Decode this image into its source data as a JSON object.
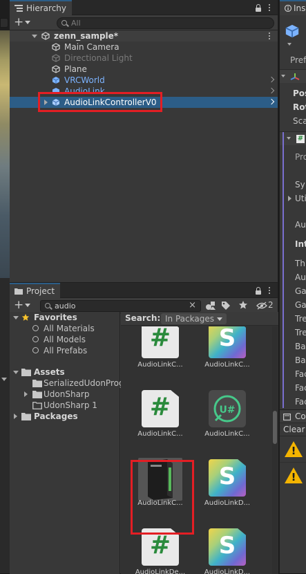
{
  "hierarchy": {
    "tab_label": "Hierarchy",
    "search_placeholder": "All",
    "scene_name": "zenn_sample*",
    "items": [
      {
        "label": "Main Camera"
      },
      {
        "label": "Directional Light"
      },
      {
        "label": "Plane"
      },
      {
        "label": "VRCWorld"
      },
      {
        "label": "AudioLink"
      },
      {
        "label": "AudioLinkControllerV0"
      }
    ]
  },
  "project": {
    "tab_label": "Project",
    "search_value": "audio",
    "filter_count": "2",
    "favorites": {
      "label": "Favorites",
      "items": [
        "All Materials",
        "All Models",
        "All Prefabs"
      ]
    },
    "assets": {
      "label": "Assets",
      "items": [
        "SerializedUdonProg",
        "UdonSharp",
        "UdonSharp 1"
      ]
    },
    "packages_label": "Packages",
    "search_label": "Search:",
    "search_scope": "In Packages",
    "grid": [
      {
        "name": "AudioLinkC...",
        "icon": "csharp-script-icon"
      },
      {
        "name": "AudioLinkC...",
        "icon": "shader-icon"
      },
      {
        "name": "AudioLinkC...",
        "icon": "csharp-script-icon"
      },
      {
        "name": "AudioLinkC...",
        "icon": "udonsharp-program-icon"
      },
      {
        "name": "AudioLinkC...",
        "icon": "prefab-icon"
      },
      {
        "name": "AudioLinkD...",
        "icon": "shader-icon"
      },
      {
        "name": "AudioLinkDe...",
        "icon": "csharp-script-icon"
      },
      {
        "name": "AudioLinkD...",
        "icon": "shader-icon"
      }
    ]
  },
  "inspector": {
    "tab_label": "Ins",
    "rows": {
      "pref": "Pref",
      "pos": "Pos",
      "rot": "Rot",
      "sca": "Sca",
      "pro": "Pro",
      "sy": "Sy",
      "uti": "Uti",
      "au": "Au",
      "int": "Int",
      "th": "Th",
      "au2": "Au",
      "ga": "Ga",
      "ga2": "Ga",
      "tre": "Tre",
      "tre2": "Tre",
      "ba": "Ba",
      "ba2": "Ba",
      "fac": "Fac",
      "fac2": "Fac",
      "fac3": "Fac"
    },
    "console_tab": "Co",
    "clear_label": "Clear"
  },
  "colors": {
    "selection": "#2c5d87",
    "highlight": "#e31e24",
    "prefab_blue": "#7cb3ff",
    "csharp_green": "#2a8a3c"
  }
}
